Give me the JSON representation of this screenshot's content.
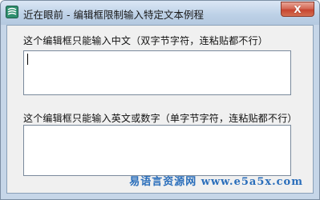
{
  "window": {
    "title": "近在眼前 - 编辑框限制输入特定文本例程",
    "close_glyph": "X",
    "icon": "app-logo-icon"
  },
  "fields": [
    {
      "label": "这个编辑框只能输入中文（双字节字符，连粘贴都不行）",
      "value": ""
    },
    {
      "label": "这个编辑框只能输入英文或数字（单字节字符，连粘贴都不行）",
      "value": ""
    }
  ],
  "watermark": "易语言资源网 www.e5a5x.com",
  "colors": {
    "title_bar": "#bcd0e6",
    "close_button": "#c74530",
    "client_bg": "#f0f0f0",
    "watermark": "#2a6ebb"
  }
}
